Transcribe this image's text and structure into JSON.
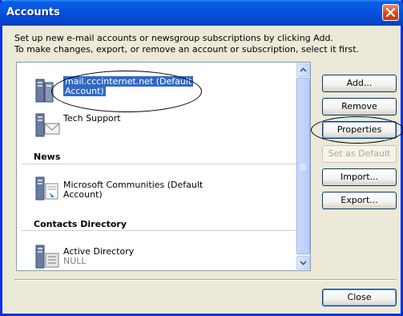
{
  "window": {
    "title": "Accounts"
  },
  "intro": {
    "line1": "Set up new e-mail accounts or newsgroup subscriptions by clicking Add.",
    "line2": "To make changes, export, or remove an account or subscription, select it first."
  },
  "list": {
    "mail_accounts": [
      {
        "name_line1": "mail.cccinternet.net  (Default",
        "name_line2": "Account)",
        "selected": true,
        "icon": "mail-server-icon"
      },
      {
        "name_line1": "Tech Support",
        "icon": "mail-server-icon"
      }
    ],
    "sections": [
      {
        "header": "News",
        "items": [
          {
            "name_line1": "Microsoft Communities (Default",
            "name_line2": "Account)",
            "icon": "news-server-icon"
          }
        ]
      },
      {
        "header": "Contacts Directory",
        "items": [
          {
            "name_line1": "Active Directory",
            "name_line2": "NULL",
            "icon": "directory-server-icon"
          }
        ]
      }
    ]
  },
  "buttons": {
    "add": "Add...",
    "remove": "Remove",
    "properties": "Properties",
    "set_default": "Set as Default",
    "import": "Import...",
    "export": "Export...",
    "close": "Close"
  },
  "colors": {
    "selection": "#316AC5",
    "titlebar": "#0653DE",
    "annotation": "#000000"
  }
}
